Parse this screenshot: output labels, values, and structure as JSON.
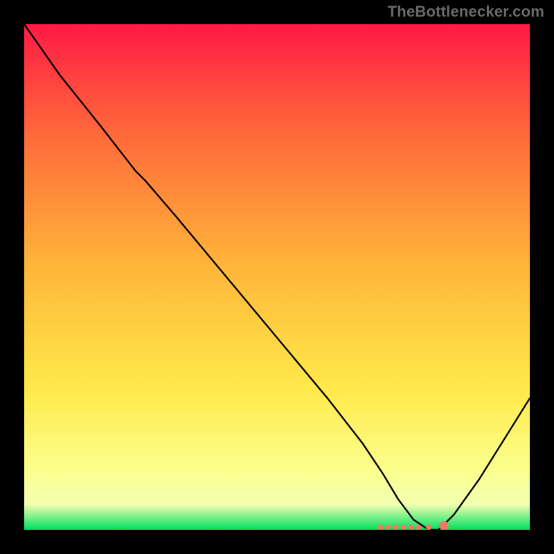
{
  "watermark": "TheBottlenecker.com",
  "chart_data": {
    "type": "line",
    "title": "",
    "xlabel": "",
    "ylabel": "",
    "xlim": [
      0,
      100
    ],
    "ylim": [
      0,
      100
    ],
    "background_gradient": {
      "top": "#ff1a45",
      "mid_top": "#ff6a3a",
      "mid": "#ffb63a",
      "mid_low": "#ffe94a",
      "low": "#fcff8c",
      "near_bottom": "#f2ffb0",
      "bottom": "#00e060"
    },
    "series": [
      {
        "name": "bottleneck-curve",
        "color": "#000000",
        "x": [
          0,
          7,
          15,
          22,
          24,
          30,
          40,
          50,
          60,
          67,
          71,
          74,
          77,
          80,
          82,
          85,
          90,
          95,
          100
        ],
        "values": [
          100,
          90,
          80,
          71,
          69,
          62,
          50,
          38,
          26,
          17,
          11,
          6,
          2,
          0,
          0,
          3,
          10,
          18,
          26
        ]
      }
    ],
    "markers": {
      "name": "optimal-range",
      "color": "#ee7a66",
      "points": [
        {
          "x": 70.5,
          "y": 0.5
        },
        {
          "x": 72,
          "y": 0.5
        },
        {
          "x": 73.5,
          "y": 0.5
        },
        {
          "x": 75,
          "y": 0.5
        },
        {
          "x": 76.5,
          "y": 0.5
        },
        {
          "x": 78,
          "y": 0.5
        },
        {
          "x": 80,
          "y": 0.5
        },
        {
          "x": 83,
          "y": 0.8
        }
      ]
    }
  }
}
